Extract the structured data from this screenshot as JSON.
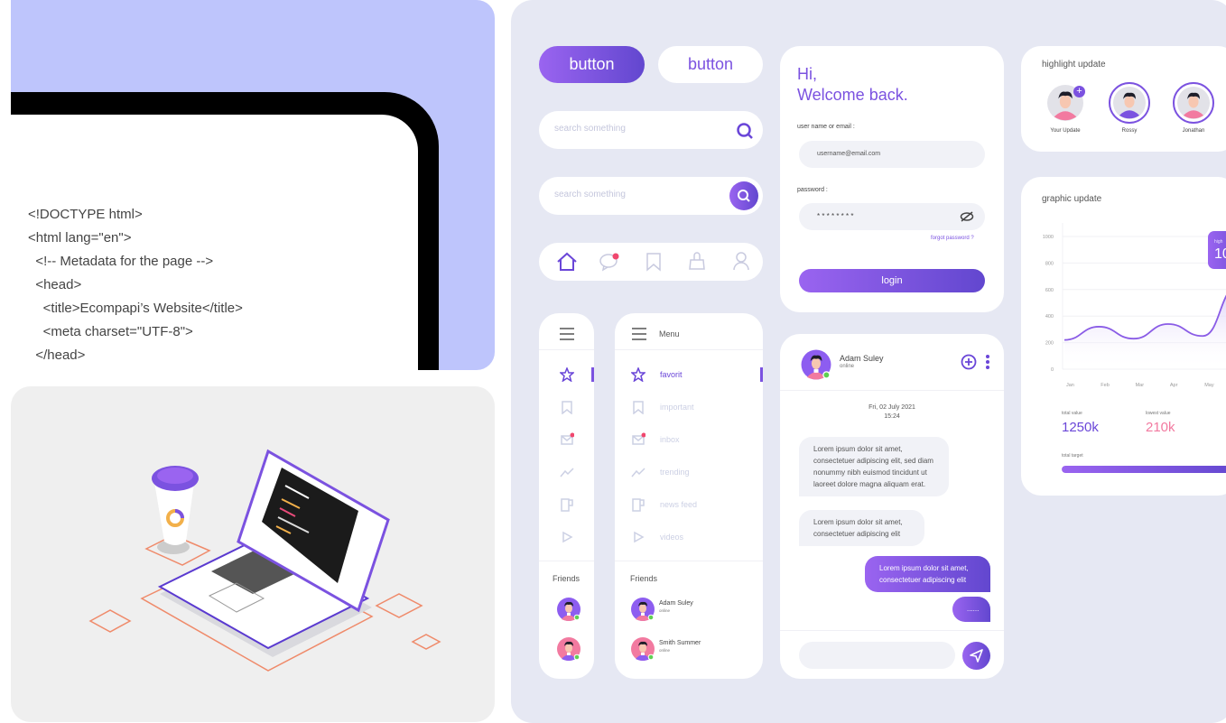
{
  "code_panel": {
    "lines": [
      "<!DOCTYPE html>",
      "<html lang=\"en\">",
      "",
      "  <!-- Metadata for the page -->",
      "  <head>",
      "    <title>Ecompapi’s Website</title>",
      "    <meta charset=\"UTF-8\">",
      "  </head>"
    ]
  },
  "buttons": {
    "primary": "button",
    "secondary": "button"
  },
  "search1": {
    "placeholder": "search something"
  },
  "search2": {
    "placeholder": "search something"
  },
  "bottom_nav": [
    "home-icon",
    "chat-icon",
    "bookmark-icon",
    "bag-icon",
    "user-icon"
  ],
  "menu": {
    "title": "Menu",
    "items": [
      {
        "label": "favorit",
        "icon": "star-icon"
      },
      {
        "label": "important",
        "icon": "bookmark-icon"
      },
      {
        "label": "inbox",
        "icon": "mail-icon"
      },
      {
        "label": "trending",
        "icon": "trending-icon"
      },
      {
        "label": "news feed",
        "icon": "news-icon"
      },
      {
        "label": "videos",
        "icon": "play-icon"
      }
    ],
    "friends_title": "Friends",
    "friends": [
      {
        "name": "Adam Suley",
        "status": "online"
      },
      {
        "name": "Smith Summer",
        "status": "online"
      }
    ],
    "mini_friends_title": "Friends"
  },
  "login": {
    "greeting": "Hi,",
    "welcome": "Welcome back.",
    "user_label": "user name or email :",
    "user_value": "username@email.com",
    "password_label": "password :",
    "password_value": "* * * * * * * *",
    "forgot": "forgot password ?",
    "login_button": "login"
  },
  "chat": {
    "name": "Adam Suley",
    "status": "online",
    "date": "Fri, 02 July 2021",
    "time": "15:24",
    "messages": [
      "Lorem ipsum dolor sit amet, consectetuer adipiscing elit, sed diam nonummy nibh euismod tincidunt ut laoreet dolore magna aliquam erat.",
      "Lorem ipsum dolor sit amet, consectetuer adipiscing elit",
      "Lorem ipsum dolor sit amet, consectetuer adipiscing elit",
      "......"
    ]
  },
  "highlight": {
    "title": "highlight update",
    "people": [
      "Your Update",
      "Rossy",
      "Jonathan"
    ]
  },
  "graphic": {
    "title": "graphic update",
    "total_label": "total value",
    "total_value": "1250k",
    "lowest_label": "lowest value",
    "lowest_value": "210k",
    "target_label": "total target",
    "target_progress": 1.0,
    "tooltip_label": "high",
    "tooltip_value": "10"
  },
  "chart_data": {
    "type": "area",
    "categories": [
      "Jan",
      "Feb",
      "Mar",
      "Apr",
      "May",
      ""
    ],
    "values": [
      220,
      320,
      230,
      340,
      250,
      620
    ],
    "ylim": [
      0,
      1000
    ],
    "yticks": [
      0,
      200,
      400,
      600,
      800,
      1000
    ],
    "grid": true
  },
  "colors": {
    "accent": "#7b52e0",
    "pink": "#f27aa0",
    "panel_bg": "#e6e8f3",
    "code_bg": "#bec5fc"
  }
}
